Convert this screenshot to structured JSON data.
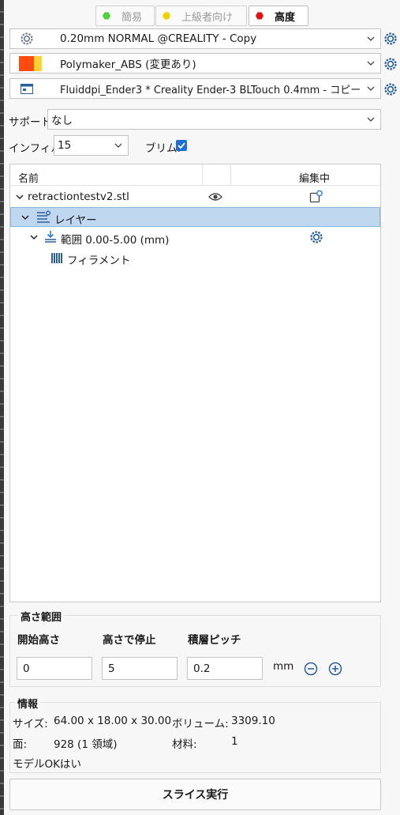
{
  "modes": {
    "simple": {
      "label": "簡易",
      "color": "#4dd33a"
    },
    "intermediate": {
      "label": "上級者向け",
      "color": "#f5d000"
    },
    "advanced": {
      "label": "高度",
      "color": "#e21212"
    }
  },
  "presets": {
    "print": {
      "value": "0.20mm NORMAL @CREALITY - Copy",
      "icon": "gear-icon"
    },
    "filament": {
      "value": "Polymaker_ABS (変更あり)",
      "icon": "filament-swatch",
      "colors": [
        "#ff4a12",
        "#ffd231"
      ]
    },
    "printer": {
      "value": "Fluiddpi_Ender3 * Creality Ender-3 BLTouch 0.4mm - コピー",
      "icon": "printer-icon"
    }
  },
  "support": {
    "label": "サポート:",
    "value": "なし"
  },
  "infill": {
    "label": "インフィル:",
    "value": "15"
  },
  "brim": {
    "label": "ブリム:",
    "checked": true
  },
  "tree": {
    "headers": {
      "name": "名前",
      "editing": "編集中"
    },
    "object": "retractiontestv2.stl",
    "layers": "レイヤー",
    "range": "範囲 0.00-5.00 (mm)",
    "filament": "フィラメント"
  },
  "height_range": {
    "title": "高さ範囲",
    "start_label": "開始高さ",
    "stop_label": "高さで停止",
    "layer_label": "積層ピッチ",
    "start": "0",
    "stop": "5",
    "layer": "0.2",
    "unit": "mm"
  },
  "info": {
    "title": "情報",
    "size_label": "サイズ:",
    "size": "64.00 x 18.00 x 30.00",
    "volume_label": "ボリューム:",
    "volume": "3309.10",
    "facets_label": "面:",
    "facets": "928 (1 領域)",
    "material_label": "材料:",
    "material": "1",
    "model_ok_label": "モデルOK:",
    "model_ok": "はい"
  },
  "slice_button": "スライス実行",
  "accent": "#1e6fd8"
}
